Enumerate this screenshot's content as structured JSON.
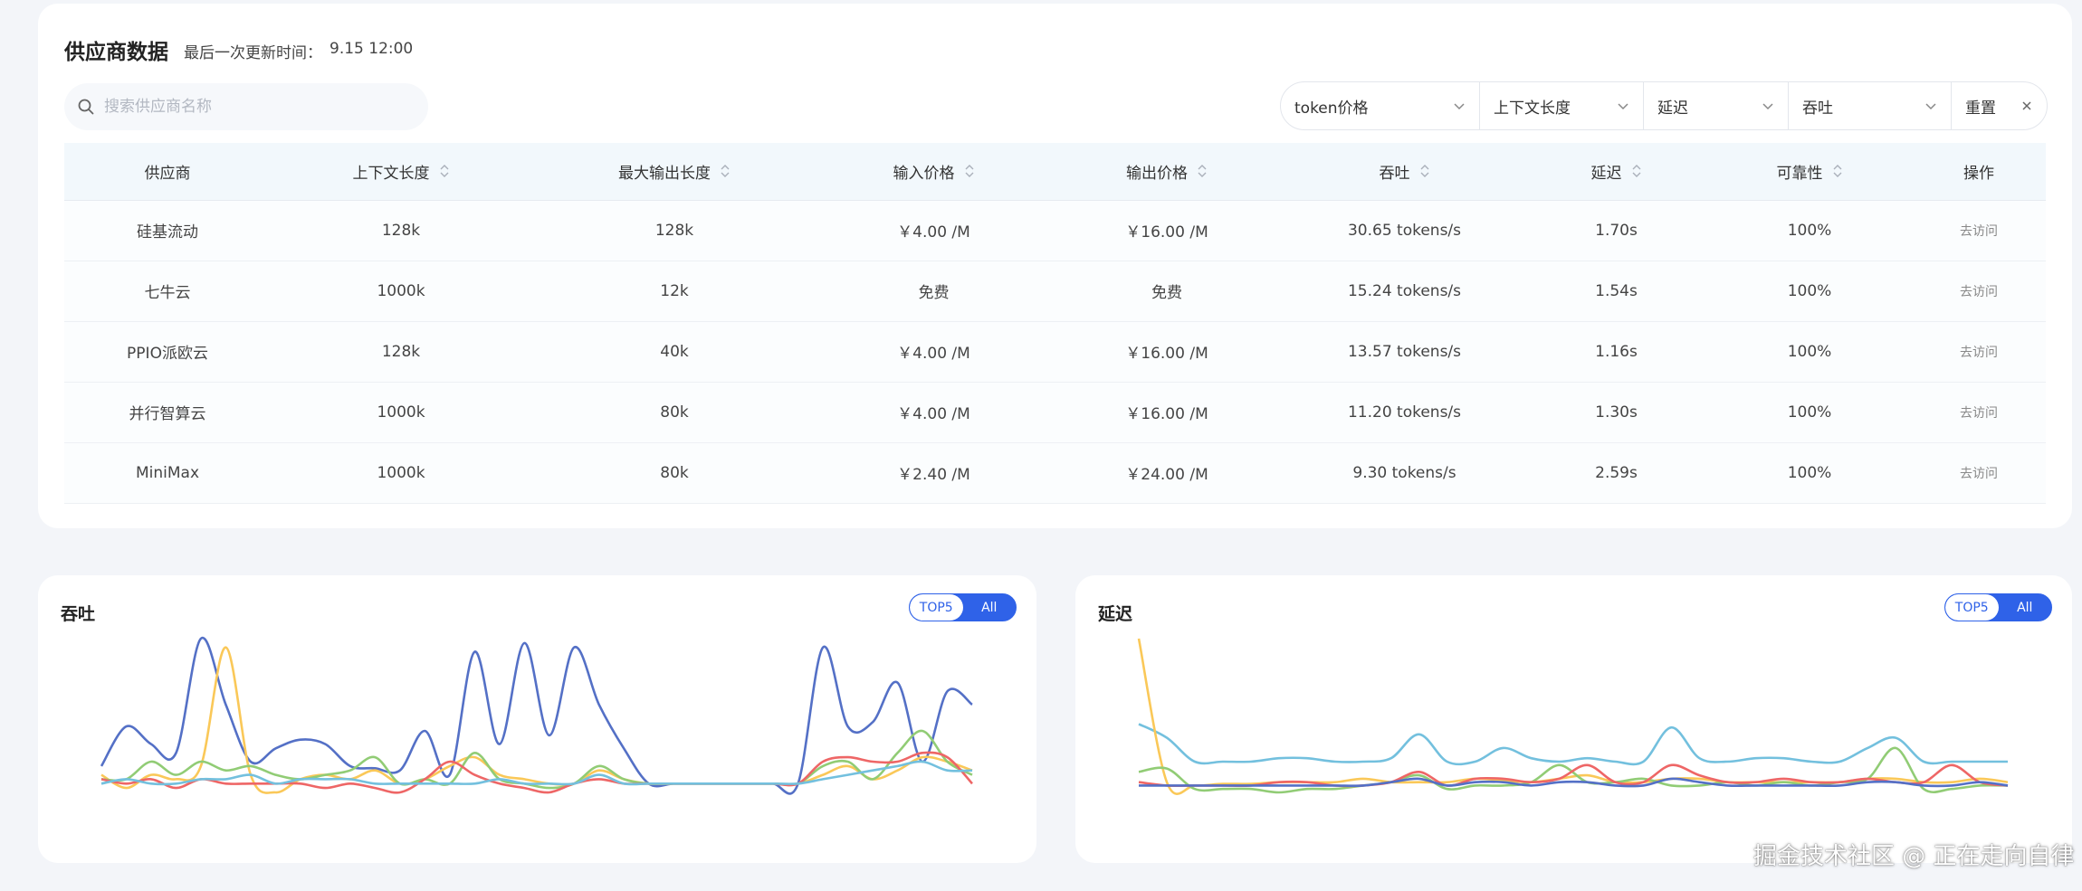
{
  "header": {
    "title": "供应商数据",
    "update_label": "最后一次更新时间：",
    "update_value": "9.15 12:00"
  },
  "search": {
    "placeholder": "搜索供应商名称",
    "icon": "search-icon"
  },
  "filters": {
    "token_price": "token价格",
    "context_length": "上下文长度",
    "latency": "延迟",
    "throughput": "吞吐",
    "reset": "重置"
  },
  "table": {
    "columns": [
      "供应商",
      "上下文长度",
      "最大输出长度",
      "输入价格",
      "输出价格",
      "吞吐",
      "延迟",
      "可靠性",
      "操作"
    ],
    "rows": [
      [
        "硅基流动",
        "128k",
        "128k",
        "￥4.00 /M",
        "￥16.00 /M",
        "30.65 tokens/s",
        "1.70s",
        "100%",
        "去访问"
      ],
      [
        "七牛云",
        "1000k",
        "12k",
        "免费",
        "免费",
        "15.24 tokens/s",
        "1.54s",
        "100%",
        "去访问"
      ],
      [
        "PPIO派欧云",
        "128k",
        "40k",
        "￥4.00 /M",
        "￥16.00 /M",
        "13.57 tokens/s",
        "1.16s",
        "100%",
        "去访问"
      ],
      [
        "并行智算云",
        "1000k",
        "80k",
        "￥4.00 /M",
        "￥16.00 /M",
        "11.20 tokens/s",
        "1.30s",
        "100%",
        "去访问"
      ],
      [
        "MiniMax",
        "1000k",
        "80k",
        "￥2.40 /M",
        "￥24.00 /M",
        "9.30 tokens/s",
        "2.59s",
        "100%",
        "去访问"
      ]
    ]
  },
  "charts": {
    "throughput": {
      "title": "吞吐",
      "toggle_top": "TOP5",
      "toggle_all": "All"
    },
    "latency": {
      "title": "延迟",
      "toggle_top": "TOP5",
      "toggle_all": "All"
    }
  },
  "colors": {
    "accent": "#2f62e8",
    "series_blue": "#5470c6",
    "series_yellow": "#fac858",
    "series_green": "#91cc75",
    "series_red": "#ee6666",
    "series_cyan": "#73c0de"
  },
  "chart_data": [
    {
      "type": "line",
      "title": "吞吐",
      "xlabel": "",
      "ylabel": "",
      "grid": false,
      "series": [
        {
          "color": "#5470c6",
          "values": [
            12,
            30,
            22,
            18,
            70,
            40,
            14,
            20,
            24,
            22,
            12,
            11,
            10,
            28,
            8,
            64,
            22,
            68,
            26,
            66,
            40,
            20,
            4,
            4,
            4,
            4,
            4,
            4,
            4,
            66,
            30,
            32,
            50,
            14,
            46,
            40
          ]
        },
        {
          "color": "#fac858",
          "values": [
            8,
            2,
            8,
            6,
            12,
            66,
            8,
            0,
            6,
            8,
            6,
            10,
            4,
            6,
            12,
            16,
            8,
            6,
            4,
            4,
            10,
            6,
            4,
            4,
            4,
            4,
            4,
            4,
            4,
            8,
            12,
            6,
            10,
            16,
            14,
            10
          ]
        },
        {
          "color": "#91cc75",
          "values": [
            6,
            6,
            14,
            8,
            14,
            10,
            12,
            8,
            6,
            8,
            10,
            16,
            4,
            6,
            4,
            18,
            6,
            4,
            2,
            4,
            12,
            6,
            4,
            4,
            4,
            4,
            4,
            4,
            4,
            12,
            14,
            6,
            18,
            28,
            14,
            8
          ]
        },
        {
          "color": "#ee6666",
          "values": [
            6,
            4,
            6,
            2,
            6,
            4,
            4,
            4,
            4,
            2,
            4,
            2,
            0,
            6,
            14,
            8,
            4,
            2,
            0,
            4,
            6,
            4,
            4,
            4,
            4,
            4,
            4,
            4,
            4,
            14,
            16,
            14,
            14,
            18,
            16,
            4
          ]
        },
        {
          "color": "#73c0de",
          "values": [
            4,
            6,
            4,
            4,
            6,
            6,
            8,
            4,
            6,
            6,
            6,
            4,
            4,
            4,
            4,
            4,
            6,
            4,
            4,
            4,
            8,
            4,
            4,
            4,
            4,
            4,
            4,
            4,
            4,
            6,
            8,
            10,
            12,
            14,
            10,
            10
          ]
        }
      ]
    },
    {
      "type": "line",
      "title": "延迟",
      "xlabel": "",
      "ylabel": "",
      "grid": false,
      "series": [
        {
          "color": "#73c0de",
          "values": [
            36,
            28,
            14,
            14,
            14,
            16,
            16,
            14,
            14,
            16,
            30,
            14,
            14,
            22,
            16,
            14,
            16,
            14,
            14,
            34,
            16,
            14,
            16,
            16,
            14,
            14,
            22,
            28,
            14,
            14,
            14,
            14
          ]
        },
        {
          "color": "#fac858",
          "values": [
            86,
            2,
            0,
            1,
            1,
            2,
            2,
            2,
            4,
            2,
            2,
            2,
            4,
            3,
            2,
            4,
            6,
            2,
            2,
            4,
            4,
            2,
            2,
            2,
            2,
            2,
            4,
            4,
            2,
            2,
            4,
            2
          ]
        },
        {
          "color": "#91cc75",
          "values": [
            8,
            10,
            -2,
            -2,
            -2,
            -4,
            -2,
            -2,
            0,
            2,
            6,
            -2,
            0,
            0,
            2,
            12,
            2,
            2,
            4,
            0,
            0,
            2,
            0,
            2,
            0,
            2,
            4,
            22,
            -2,
            -2,
            0,
            0
          ]
        },
        {
          "color": "#ee6666",
          "values": [
            2,
            0,
            0,
            0,
            0,
            2,
            2,
            0,
            0,
            2,
            8,
            0,
            4,
            4,
            2,
            4,
            12,
            2,
            2,
            12,
            6,
            2,
            2,
            4,
            2,
            2,
            4,
            2,
            2,
            12,
            2,
            0
          ]
        },
        {
          "color": "#5470c6",
          "values": [
            0,
            0,
            0,
            0,
            0,
            0,
            0,
            0,
            0,
            2,
            4,
            0,
            2,
            2,
            0,
            2,
            2,
            0,
            0,
            4,
            2,
            0,
            0,
            0,
            0,
            0,
            2,
            2,
            0,
            0,
            2,
            0
          ]
        }
      ]
    }
  ],
  "watermark": "掘金技术社区 @ 正在走向自律"
}
